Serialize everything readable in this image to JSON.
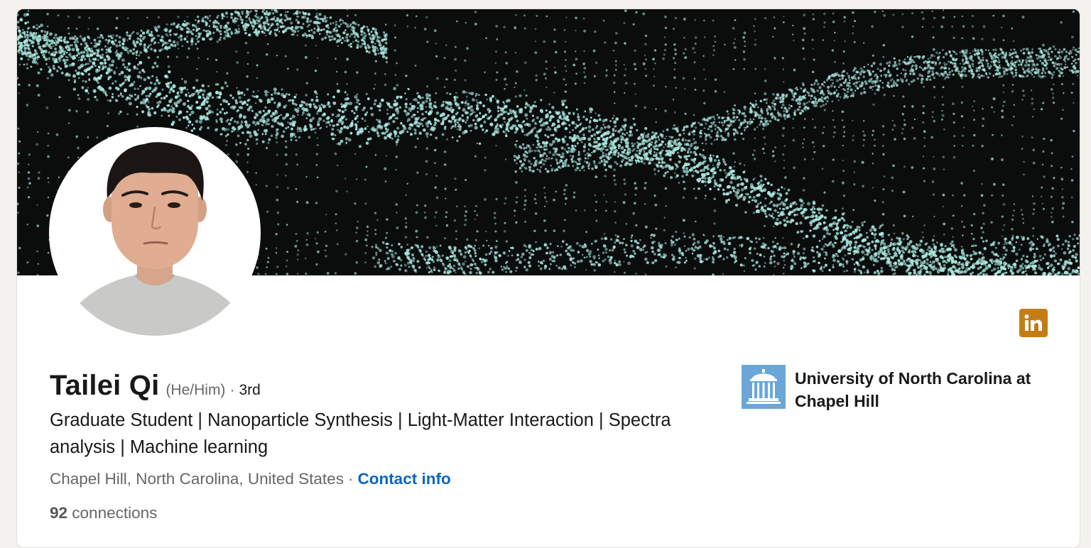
{
  "profile": {
    "name": "Tailei Qi",
    "pronouns": "(He/Him)",
    "separator": "·",
    "degree": "3rd",
    "headline": "Graduate Student | Nanoparticle Synthesis | Light-Matter Interaction | Spectra analysis | Machine learning",
    "location": "Chapel Hill, North Carolina, United States",
    "location_separator": "·",
    "contact_label": "Contact info",
    "connections_count": "92",
    "connections_label": "connections"
  },
  "education": {
    "school_name": "University of North Carolina at Chapel Hill",
    "logo_icon": "old-well-icon"
  },
  "badge": {
    "text": "in",
    "icon": "linkedin-icon",
    "color": "#c37d16"
  },
  "banner": {
    "background_color": "#0b0c0c",
    "particle_color": "#a8e6de"
  },
  "colors": {
    "link": "#0a66c2",
    "text_primary": "#191919",
    "text_secondary": "#666666",
    "school_logo": "#6aa6d8"
  }
}
